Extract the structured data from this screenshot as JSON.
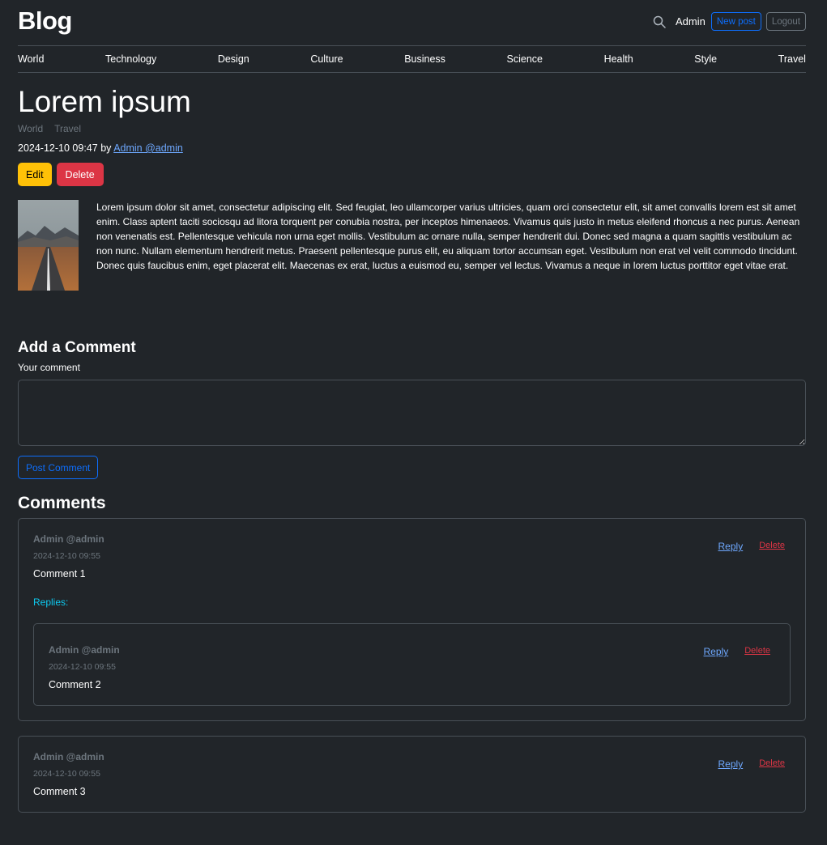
{
  "header": {
    "brand": "Blog",
    "user_label": "Admin",
    "new_post_label": "New post",
    "logout_label": "Logout"
  },
  "nav": [
    "World",
    "Technology",
    "Design",
    "Culture",
    "Business",
    "Science",
    "Health",
    "Style",
    "Travel"
  ],
  "post": {
    "title": "Lorem ipsum",
    "tags": [
      "World",
      "Travel"
    ],
    "date": "2024-12-10 09:47",
    "by_label": "by",
    "author": "Admin @admin",
    "edit_label": "Edit",
    "delete_label": "Delete",
    "body": "Lorem ipsum dolor sit amet, consectetur adipiscing elit. Sed feugiat, leo ullamcorper varius ultricies, quam orci consectetur elit, sit amet convallis lorem est sit amet enim. Class aptent taciti sociosqu ad litora torquent per conubia nostra, per inceptos himenaeos. Vivamus quis justo in metus eleifend rhoncus a nec purus. Aenean non venenatis est. Pellentesque vehicula non urna eget mollis. Vestibulum ac ornare nulla, semper hendrerit dui. Donec sed magna a quam sagittis vestibulum ac non nunc. Nullam elementum hendrerit metus. Praesent pellentesque purus elit, eu aliquam tortor accumsan eget. Vestibulum non erat vel velit commodo tincidunt. Donec quis faucibus enim, eget placerat elit. Maecenas ex erat, luctus a euismod eu, semper vel lectus. Vivamus a neque in lorem luctus porttitor eget vitae erat."
  },
  "add_comment": {
    "heading": "Add a Comment",
    "label": "Your comment",
    "value": "",
    "submit_label": "Post Comment"
  },
  "comments_heading": "Comments",
  "comments": [
    {
      "author": "Admin @admin",
      "time": "2024-12-10 09:55",
      "body": "Comment 1",
      "reply_label": "Reply",
      "delete_label": "Delete",
      "replies_label": "Replies:",
      "replies": [
        {
          "author": "Admin @admin",
          "time": "2024-12-10 09:55",
          "body": "Comment 2",
          "reply_label": "Reply",
          "delete_label": "Delete"
        }
      ]
    },
    {
      "author": "Admin @admin",
      "time": "2024-12-10 09:55",
      "body": "Comment 3",
      "reply_label": "Reply",
      "delete_label": "Delete"
    }
  ],
  "colors": {
    "background": "#212529",
    "primary": "#0d6efd",
    "warning": "#ffc107",
    "danger": "#dc3545",
    "info": "#0dcaf0",
    "muted": "#6c757d"
  },
  "icons": {
    "search": "search-icon",
    "post_image": "road-landscape-image"
  }
}
